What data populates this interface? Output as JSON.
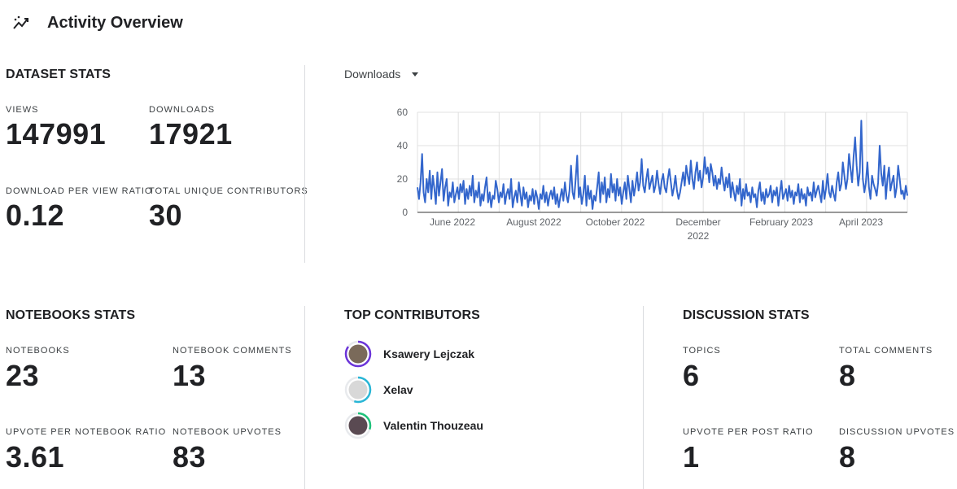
{
  "header": {
    "title": "Activity Overview",
    "icon": "trending-icon"
  },
  "dataset_stats": {
    "title": "DATASET STATS",
    "items": [
      {
        "label": "VIEWS",
        "value": "147991"
      },
      {
        "label": "DOWNLOADS",
        "value": "17921"
      },
      {
        "label": "DOWNLOAD PER VIEW RATIO",
        "value": "0.12"
      },
      {
        "label": "TOTAL UNIQUE CONTRIBUTORS",
        "value": "30"
      }
    ]
  },
  "metric_selector": {
    "selected": "Downloads",
    "icon": "caret-down-icon"
  },
  "chart_data": {
    "type": "line",
    "x_tick_labels": [
      "June 2022",
      "August 2022",
      "October 2022",
      "December 2022",
      "February 2023",
      "April 2023"
    ],
    "y_tick_labels": [
      "0",
      "20",
      "40",
      "60"
    ],
    "ylim": [
      0,
      60
    ],
    "x_range": [
      "2022-04-24",
      "2023-05-22"
    ],
    "grid": true,
    "line_color": "#3366cc",
    "series": [
      {
        "values": [
          15,
          8,
          18,
          35,
          12,
          6,
          20,
          12,
          25,
          8,
          22,
          14,
          5,
          24,
          10,
          18,
          26,
          7,
          15,
          20,
          4,
          12,
          9,
          18,
          6,
          11,
          15,
          8,
          17,
          12,
          19,
          5,
          14,
          8,
          16,
          10,
          22,
          6,
          13,
          9,
          18,
          4,
          11,
          7,
          15,
          21,
          6,
          12,
          3,
          10,
          8,
          19,
          14,
          6,
          12,
          9,
          17,
          5,
          11,
          14,
          8,
          20,
          3,
          9,
          13,
          6,
          18,
          11,
          4,
          15,
          8,
          12,
          3,
          10,
          7,
          14,
          5,
          13,
          9,
          2,
          11,
          8,
          16,
          6,
          12,
          4,
          10,
          13,
          8,
          15,
          5,
          11,
          3,
          9,
          14,
          7,
          18,
          10,
          6,
          13,
          28,
          12,
          8,
          20,
          34,
          9,
          15,
          5,
          11,
          22,
          4,
          16,
          8,
          13,
          2,
          10,
          7,
          15,
          24,
          6,
          18,
          11,
          21,
          6,
          14,
          9,
          23,
          12,
          17,
          7,
          20,
          10,
          15,
          5,
          12,
          18,
          8,
          22,
          14,
          6,
          19,
          10,
          16,
          24,
          13,
          18,
          32,
          16,
          12,
          20,
          26,
          14,
          18,
          22,
          12,
          16,
          25,
          17,
          11,
          19,
          23,
          15,
          12,
          20,
          26,
          18,
          10,
          15,
          22,
          13,
          8,
          12,
          18,
          24,
          16,
          28,
          22,
          17,
          31,
          20,
          14,
          24,
          30,
          19,
          25,
          15,
          21,
          33,
          23,
          27,
          18,
          29,
          24,
          16,
          22,
          14,
          20,
          17,
          27,
          19,
          13,
          21,
          15,
          23,
          9,
          18,
          12,
          7,
          16,
          11,
          20,
          4,
          14,
          8,
          17,
          10,
          12,
          6,
          15,
          9,
          11,
          3,
          13,
          18,
          7,
          12,
          5,
          14,
          9,
          11,
          16,
          6,
          13,
          10,
          15,
          4,
          12,
          19,
          8,
          11,
          14,
          7,
          16,
          9,
          13,
          5,
          12,
          10,
          17,
          6,
          14,
          8,
          11,
          4,
          15,
          10,
          12,
          7,
          18,
          9,
          13,
          16,
          11,
          6,
          19,
          8,
          14,
          23,
          12,
          9,
          16,
          11,
          7,
          18,
          24,
          13,
          17,
          30,
          22,
          14,
          20,
          35,
          26,
          18,
          33,
          45,
          28,
          16,
          24,
          55,
          20,
          12,
          18,
          30,
          15,
          8,
          22,
          17,
          14,
          10,
          18,
          40,
          23,
          16,
          28,
          8,
          20,
          27,
          13,
          18,
          22,
          9,
          15,
          28,
          20,
          11,
          13,
          8,
          16,
          10
        ]
      }
    ]
  },
  "notebooks_stats": {
    "title": "NOTEBOOKS STATS",
    "items": [
      {
        "label": "NOTEBOOKS",
        "value": "23"
      },
      {
        "label": "NOTEBOOK COMMENTS",
        "value": "13"
      },
      {
        "label": "UPVOTE PER NOTEBOOK RATIO",
        "value": "3.61"
      },
      {
        "label": "NOTEBOOK UPVOTES",
        "value": "83"
      }
    ]
  },
  "top_contributors": {
    "title": "TOP CONTRIBUTORS",
    "items": [
      {
        "name": "Ksawery Lejczak",
        "ring_color": "#6b34d9",
        "ring_fraction": 0.85,
        "avatar_color": "#7a6a5a"
      },
      {
        "name": "Xelav",
        "ring_color": "#29b6d6",
        "ring_fraction": 0.55,
        "avatar_color": "#d8d8d8"
      },
      {
        "name": "Valentin Thouzeau",
        "ring_color": "#1ec27a",
        "ring_fraction": 0.3,
        "avatar_color": "#5a4a52"
      }
    ]
  },
  "discussion_stats": {
    "title": "DISCUSSION STATS",
    "items": [
      {
        "label": "TOPICS",
        "value": "6"
      },
      {
        "label": "TOTAL COMMENTS",
        "value": "8"
      },
      {
        "label": "UPVOTE PER POST RATIO",
        "value": "1"
      },
      {
        "label": "DISCUSSION UPVOTES",
        "value": "8"
      }
    ]
  }
}
